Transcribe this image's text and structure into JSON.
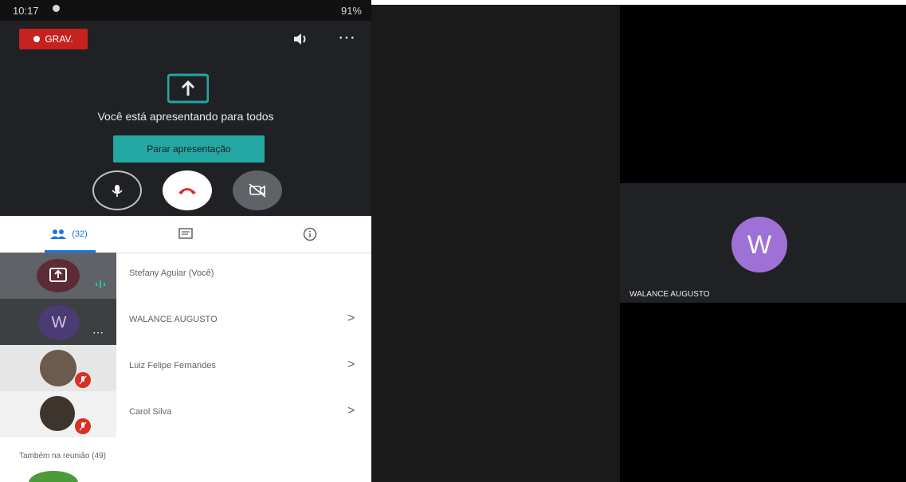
{
  "status_bar": {
    "time": "10:17",
    "right": "91%"
  },
  "meeting": {
    "rec_label": "GRAV.",
    "presenting_text": "Você está apresentando para todos",
    "stop_label": "Parar apresentação"
  },
  "tabs": {
    "people_count": "(32)"
  },
  "participants": [
    {
      "name": "Stefany Aguiar (Você)"
    },
    {
      "name": "WALANCE AUGUSTO",
      "initial": "W"
    },
    {
      "name": "Luiz Felipe Fernandes"
    },
    {
      "name": "Carol Silva"
    }
  ],
  "also_in_meeting": "Também na reunião (49)",
  "tile": {
    "initial": "W",
    "name": "WALANCE AUGUSTO"
  },
  "colors": {
    "record": "#c5221f",
    "accent": "#24a8a3",
    "avatar": "#9f71d6",
    "mute": "#d93025"
  }
}
